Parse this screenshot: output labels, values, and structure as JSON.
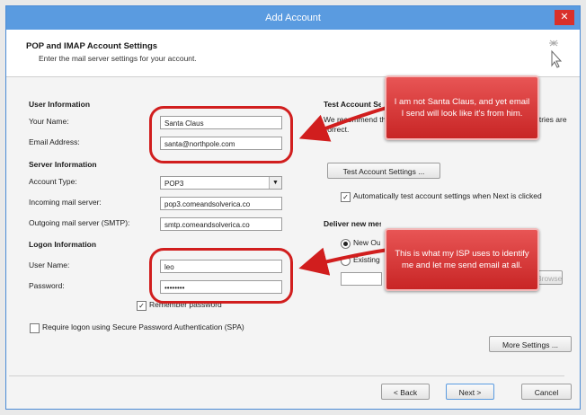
{
  "window": {
    "title": "Add Account",
    "close_glyph": "✕"
  },
  "header": {
    "title": "POP and IMAP Account Settings",
    "subtitle": "Enter the mail server settings for your account."
  },
  "user_info": {
    "section_title": "User Information",
    "your_name_label": "Your Name:",
    "your_name_value": "Santa Claus",
    "email_label": "Email Address:",
    "email_value": "santa@northpole.com"
  },
  "server_info": {
    "section_title": "Server Information",
    "account_type_label": "Account Type:",
    "account_type_value": "POP3",
    "incoming_label": "Incoming mail server:",
    "incoming_value": "pop3.comeandsolverica.co",
    "outgoing_label": "Outgoing mail server (SMTP):",
    "outgoing_value": "smtp.comeandsolverica.co"
  },
  "logon_info": {
    "section_title": "Logon Information",
    "user_name_label": "User Name:",
    "user_name_value": "leo",
    "password_label": "Password:",
    "password_value": "••••••••",
    "remember_password_label": "Remember password",
    "spa_label": "Require logon using Secure Password Authentication (SPA)"
  },
  "test_settings": {
    "section_title": "Test Account Settings",
    "description": "We recommend that you test your account to ensure that the entries are correct.",
    "test_button": "Test Account Settings ...",
    "auto_test_label": "Automatically test account settings when Next is clicked",
    "deliver_title": "Deliver new messages to:",
    "radio_new_label": "New Outlook Data File",
    "radio_existing_label": "Existing Outlook Data File",
    "browse_button": "Browse",
    "more_settings_button": "More Settings ..."
  },
  "footer": {
    "back_button": "< Back",
    "next_button": "Next >",
    "cancel_button": "Cancel"
  },
  "callouts": {
    "top": "I am not Santa Claus, and yet email I send will look like it's from him.",
    "bottom": "This is what my ISP uses to identify me and let me send email at all."
  },
  "colors": {
    "title_bar": "#5a9be0",
    "annotation_red": "#d11e1e",
    "callout_fill": "#d63a3a"
  }
}
